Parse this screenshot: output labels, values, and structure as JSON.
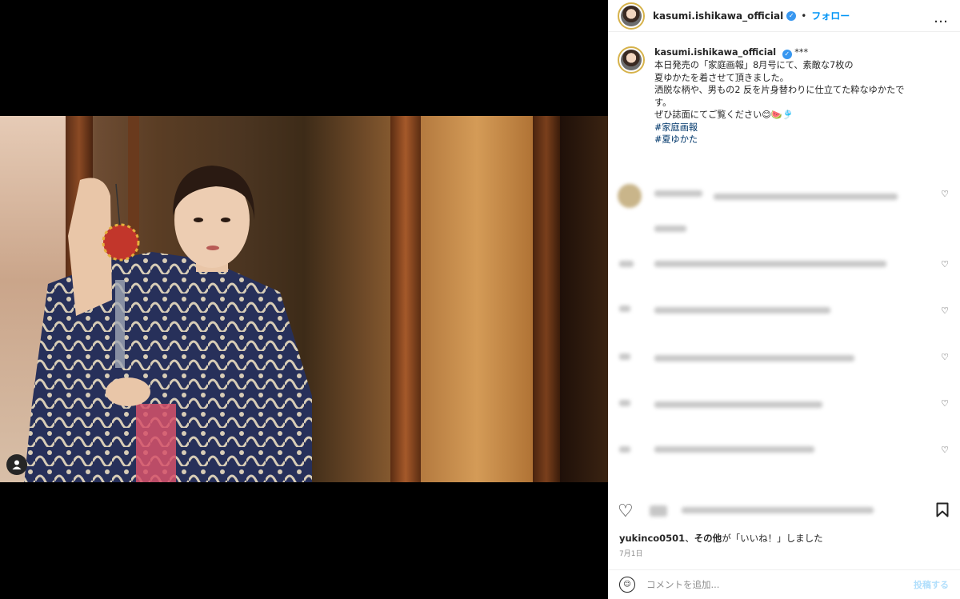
{
  "header": {
    "username": "kasumi.ishikawa_official",
    "verified_mark": "✓",
    "separator": "•",
    "follow_label": "フォロー",
    "more_icon": "…"
  },
  "caption": {
    "username": "kasumi.ishikawa_official",
    "verified_mark": "✓",
    "stars": "***",
    "lines": [
      "本日発売の「家庭画報」8月号にて、素敵な7枚の",
      "夏ゆかたを着させて頂きました。",
      "洒脱な柄や、男もの2 反を片身替わりに仕立てた粋なゆかたで",
      "す。",
      "ぜひ誌面にてご覧ください😊🍉🎐"
    ],
    "hashtags": [
      "#家庭画報",
      "#夏ゆかた"
    ]
  },
  "actions": {
    "like_icon": "♡",
    "bookmark_icon": "⚑"
  },
  "likes": {
    "user": "yukinco0501",
    "sep": "、",
    "others": "その他",
    "rest": "が「いいね！」しました"
  },
  "date": "7月1日",
  "comment_box": {
    "emoji_icon": "☺",
    "placeholder": "コメントを追加...",
    "post_label": "投稿する"
  },
  "colors": {
    "verified": "#3897f0",
    "follow": "#0095f6",
    "hashtag": "#00376b",
    "post_disabled": "#b2dffc"
  }
}
